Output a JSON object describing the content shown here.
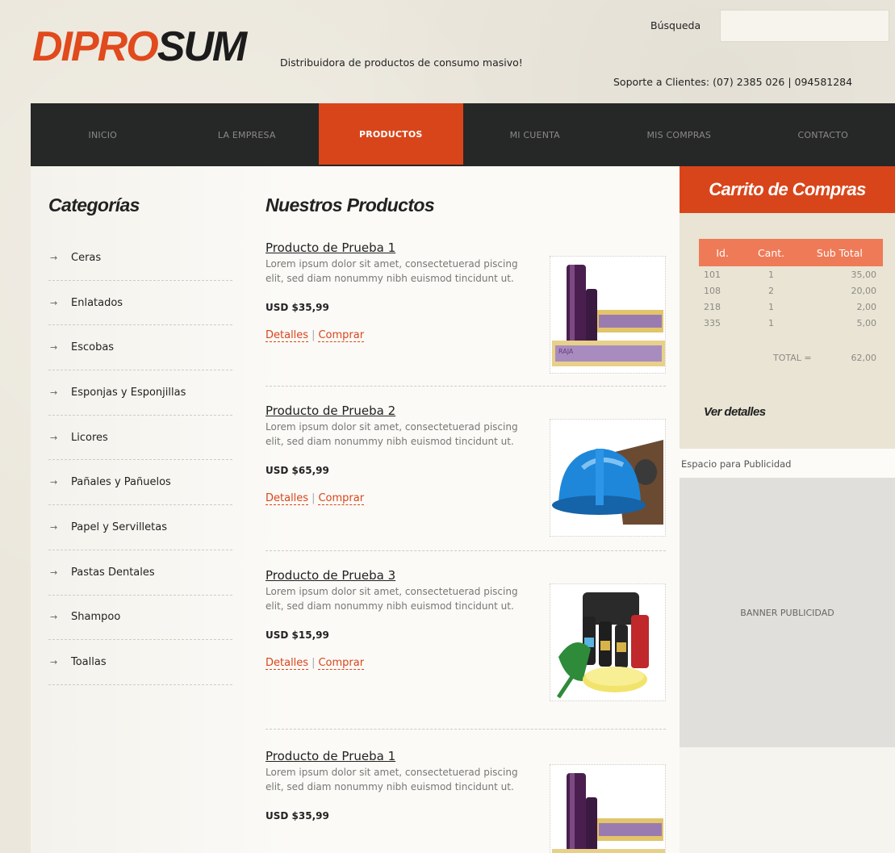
{
  "header": {
    "logo_part1": "DIPRO",
    "logo_part2": "SUM",
    "tagline": "Distribuidora de productos de consumo masivo!",
    "search_label": "Búsqueda",
    "search_value": "",
    "support": "Soporte a Clientes: (07) 2385 026 | 094581284"
  },
  "nav": {
    "items": [
      {
        "label": "INICIO",
        "active": false
      },
      {
        "label": "LA EMPRESA",
        "active": false
      },
      {
        "label": "PRODUCTOS",
        "active": true
      },
      {
        "label": "MI CUENTA",
        "active": false
      },
      {
        "label": "MIS COMPRAS",
        "active": false
      },
      {
        "label": "CONTACTO",
        "active": false
      }
    ]
  },
  "categories": {
    "title": "Categorías",
    "items": [
      "Ceras",
      "Enlatados",
      "Escobas",
      "Esponjas y Esponjillas",
      "Licores",
      "Pañales y Pañuelos",
      "Papel y Servilletas",
      "Pastas Dentales",
      "Shampoo",
      "Toallas"
    ]
  },
  "products": {
    "title": "Nuestros Productos",
    "details_label": "Detalles",
    "buy_label": "Comprar",
    "separator": "|",
    "items": [
      {
        "name": "Producto de Prueba 1",
        "description": "Lorem ipsum dolor sit amet, consectetuerad piscing elit, sed diam nonummy nibh euismod tincidunt ut.",
        "price": "USD $35,99",
        "image": "plastic-wrap-rolls"
      },
      {
        "name": "Producto de Prueba 2",
        "description": "Lorem ipsum dolor sit amet, consectetuerad piscing elit, sed diam nonummy nibh euismod tincidunt ut.",
        "price": "USD $65,99",
        "image": "blue-hard-hat"
      },
      {
        "name": "Producto de Prueba 3",
        "description": "Lorem ipsum dolor sit amet, consectetuerad piscing elit, sed diam nonummy nibh euismod tincidunt ut.",
        "price": "USD $15,99",
        "image": "car-care-kit"
      },
      {
        "name": "Producto de Prueba 1",
        "description": "Lorem ipsum dolor sit amet, consectetuerad piscing elit, sed diam nonummy nibh euismod tincidunt ut.",
        "price": "USD $35,99",
        "image": "plastic-wrap-rolls"
      }
    ]
  },
  "cart": {
    "title": "Carrito de Compras",
    "columns": [
      "Id.",
      "Cant.",
      "Sub Total"
    ],
    "rows": [
      {
        "id": "101",
        "qty": "1",
        "subtotal": "35,00"
      },
      {
        "id": "108",
        "qty": "2",
        "subtotal": "20,00"
      },
      {
        "id": "218",
        "qty": "1",
        "subtotal": "2,00"
      },
      {
        "id": "335",
        "qty": "1",
        "subtotal": "5,00"
      }
    ],
    "total_label": "TOTAL =",
    "total_value": "62,00",
    "details_link": "Ver detalles"
  },
  "ads": {
    "label": "Espacio para Publicidad",
    "banner_text": "BANNER PUBLICIDAD"
  },
  "colors": {
    "accent": "#d9451a",
    "nav_bg": "#262727",
    "cart_header": "#ef7a57"
  }
}
